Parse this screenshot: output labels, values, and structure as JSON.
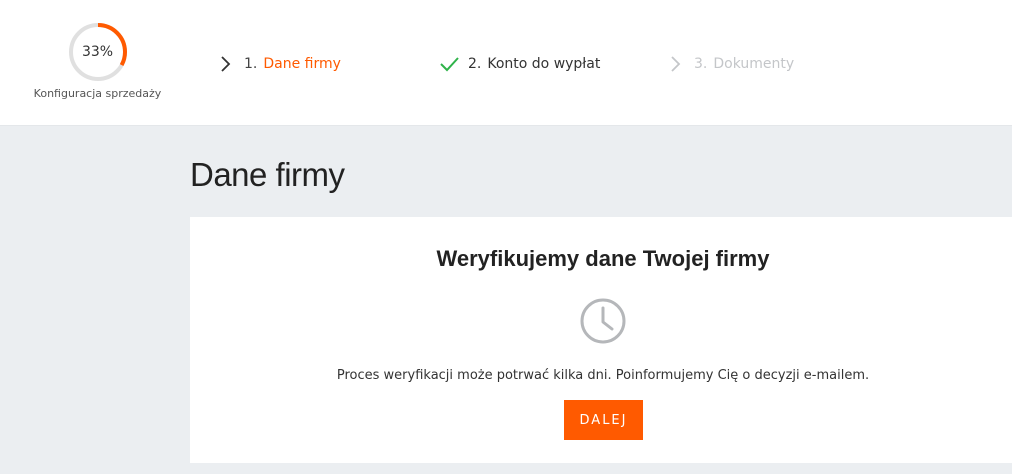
{
  "progress": {
    "value_label": "33%",
    "percent": 33,
    "label": "Konfiguracja sprzedaży",
    "accent_color": "#ff5a00",
    "track_color": "#e0e0e0"
  },
  "steps": [
    {
      "num": "1.",
      "label": "Dane firmy",
      "state": "current",
      "icon": "chevron-right-icon"
    },
    {
      "num": "2.",
      "label": "Konto do wypłat",
      "state": "done",
      "icon": "check-icon"
    },
    {
      "num": "3.",
      "label": "Dokumenty",
      "state": "disabled",
      "icon": "chevron-right-icon"
    }
  ],
  "main": {
    "page_title": "Dane firmy",
    "card": {
      "title": "Weryfikujemy dane Twojej firmy",
      "icon": "clock-icon",
      "message": "Proces weryfikacji może potrwać kilka dni. Poinformujemy Cię o decyzji e-mailem.",
      "button_label": "DALEJ"
    }
  },
  "colors": {
    "accent": "#ff5a00",
    "success": "#2fb34a",
    "muted": "#c4c6c9",
    "background": "#ebeef1"
  }
}
